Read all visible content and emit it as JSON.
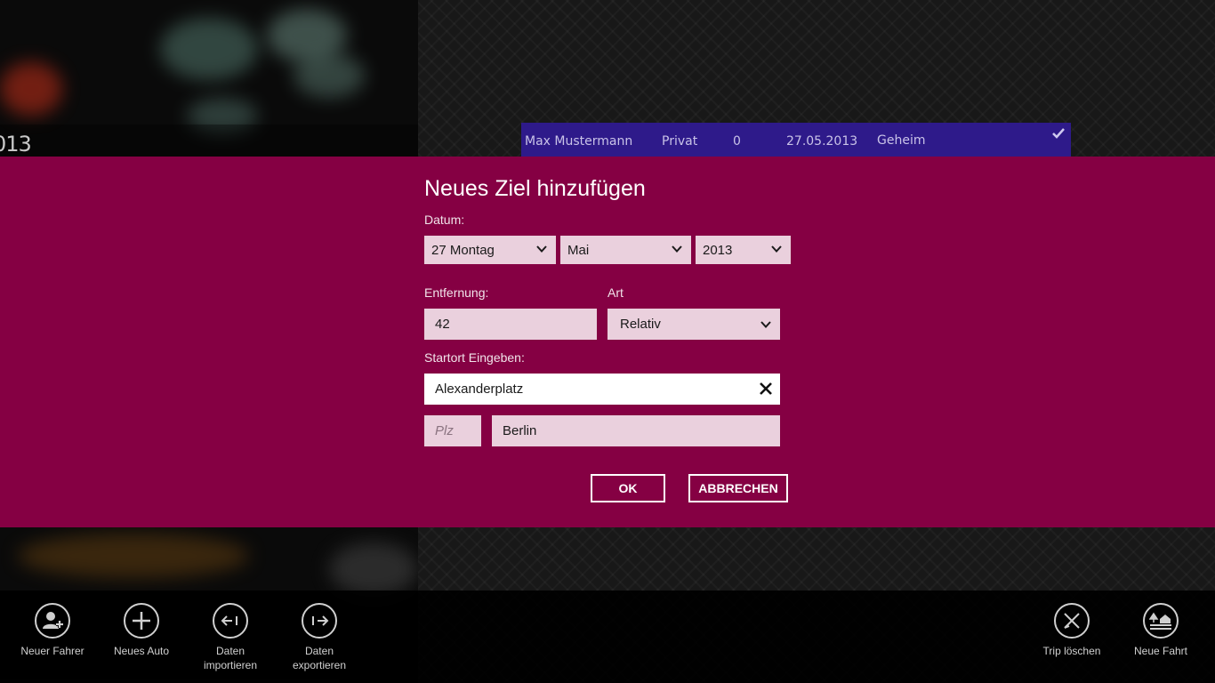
{
  "background": {
    "photo_year_fragment": "013"
  },
  "trip_row": {
    "driver": "Max Mustermann",
    "type": "Privat",
    "distance": "0",
    "date": "27.05.2013",
    "note": "Geheim",
    "accent_color": "#2e1a8a"
  },
  "dialog": {
    "title": "Neues Ziel hinzufügen",
    "accent_color": "#850043",
    "date_label": "Datum:",
    "day_value": "27 Montag",
    "month_value": "Mai",
    "year_value": "2013",
    "distance_label": "Entfernung:",
    "distance_value": "42",
    "art_label": "Art",
    "art_value": "Relativ",
    "start_label": "Startort Eingeben:",
    "start_value": "Alexanderplatz",
    "plz_placeholder": "Plz",
    "city_value": "Berlin",
    "ok_label": "OK",
    "cancel_label": "ABBRECHEN"
  },
  "appbar": {
    "left": [
      {
        "label": "Neuer Fahrer",
        "icon": "add-user-icon"
      },
      {
        "label": "Neues Auto",
        "icon": "plus-icon"
      },
      {
        "label_line1": "Daten",
        "label_line2": "importieren",
        "icon": "import-icon"
      },
      {
        "label_line1": "Daten",
        "label_line2": "exportieren",
        "icon": "export-icon"
      }
    ],
    "right": [
      {
        "label": "Trip löschen",
        "icon": "delete-trip-icon"
      },
      {
        "label": "Neue Fahrt",
        "icon": "new-trip-icon"
      }
    ]
  }
}
